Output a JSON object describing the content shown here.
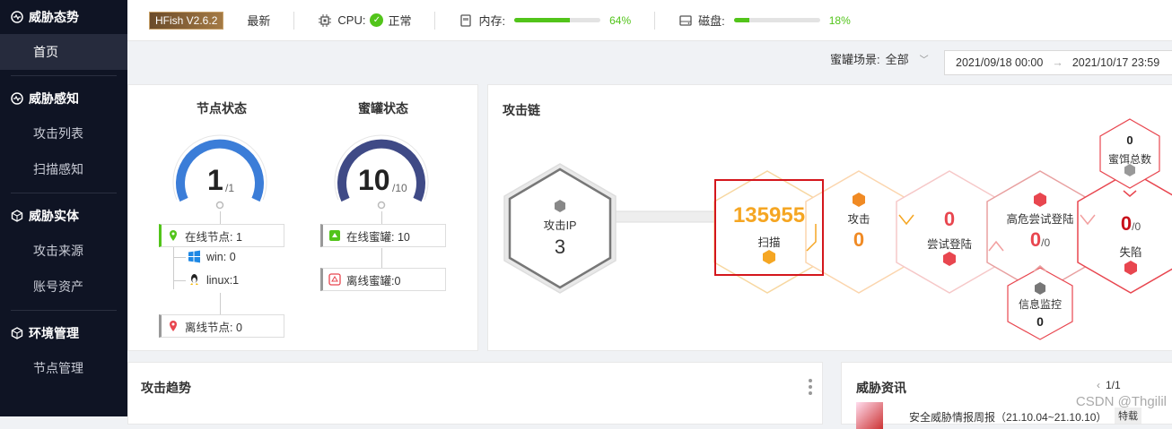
{
  "sidebar": {
    "groups": [
      {
        "label": "威胁态势",
        "items": [
          "首页"
        ]
      },
      {
        "label": "威胁感知",
        "items": [
          "攻击列表",
          "扫描感知"
        ]
      },
      {
        "label": "威胁实体",
        "items": [
          "攻击来源",
          "账号资产"
        ]
      },
      {
        "label": "环境管理",
        "items": [
          "节点管理"
        ]
      }
    ]
  },
  "topbar": {
    "logo": "HFish V2.6.2",
    "latest": "最新",
    "cpu_label": "CPU:",
    "cpu_status": "正常",
    "mem_label": "内存:",
    "mem_pct": "64%",
    "mem_value": 0.64,
    "disk_label": "磁盘:",
    "disk_pct": "18%",
    "disk_value": 0.18
  },
  "filter": {
    "scene_label": "蜜罐场景:",
    "scene_value": "全部",
    "date_start": "2021/09/18 00:00",
    "date_end": "2021/10/17 23:59"
  },
  "node_status": {
    "title": "节点状态",
    "value": "1",
    "total": "/1",
    "online": "在线节点: 1",
    "win": "win: 0",
    "linux": "linux:1",
    "offline": "离线节点: 0"
  },
  "honeypot_status": {
    "title": "蜜罐状态",
    "value": "10",
    "total": "/10",
    "online": "在线蜜罐: 10",
    "offline": "离线蜜罐:0"
  },
  "attack_chain": {
    "title": "攻击链",
    "attack_ip_label": "攻击IP",
    "attack_ip_value": "3",
    "scan_value": "135955",
    "scan_label": "扫描",
    "attack_label": "攻击",
    "attack_value": "0",
    "try_login_value": "0",
    "try_login_label": "尝试登陆",
    "high_risk_label": "高危尝试登陆",
    "high_risk_value": "0",
    "high_risk_total": "/0",
    "fall_value": "0",
    "fall_total": "/0",
    "fall_label": "失陷",
    "bait_value": "0",
    "bait_label": "蜜饵总数",
    "monitor_label": "信息监控",
    "monitor_value": "0"
  },
  "trend": {
    "title": "攻击趋势"
  },
  "intel": {
    "title": "威胁资讯",
    "page": "1/1",
    "item": "安全威胁情报周报（21.10.04~21.10.10）",
    "tag": "特载"
  },
  "watermark": "CSDN @Thgilil",
  "colors": {
    "accent": "#52c41a",
    "orange": "#f5a623",
    "red": "#e8464f",
    "gauge_blue": "#3b7dd8",
    "gauge_navy": "#3f4a86"
  }
}
